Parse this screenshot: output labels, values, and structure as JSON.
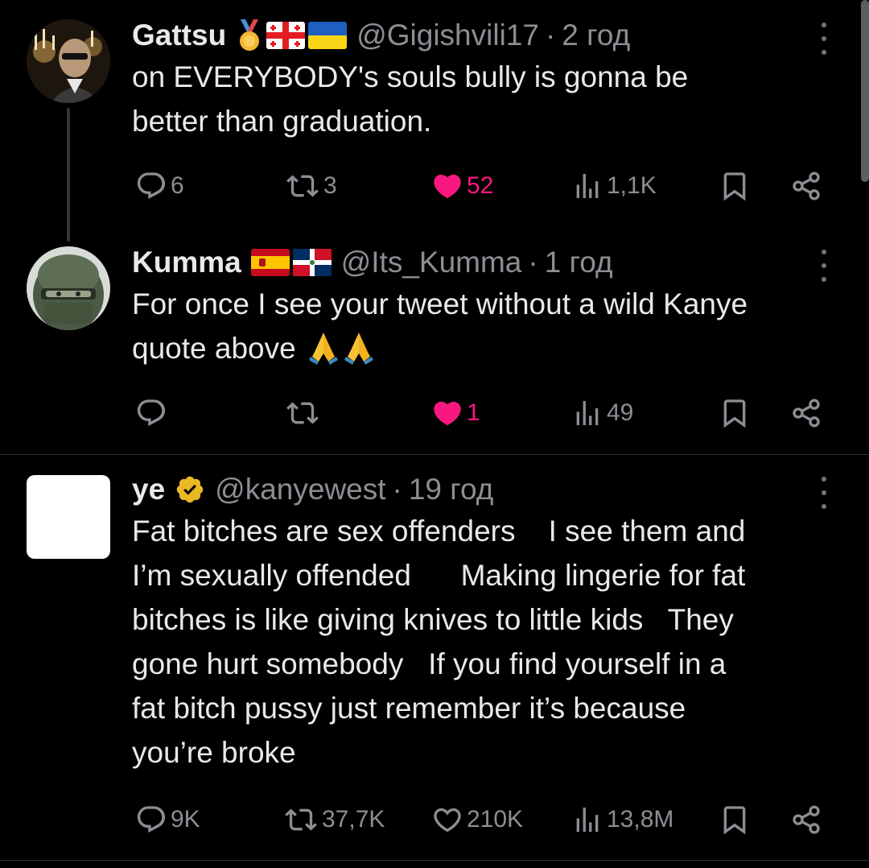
{
  "tweets": [
    {
      "name": "Gattsu",
      "handle": "@Gigishvili17",
      "separator": "·",
      "time": "2 год",
      "text": "on EVERYBODY's souls bully is gonna be\nbetter than graduation.",
      "replies": "6",
      "retweets": "3",
      "likes": "52",
      "views": "1,1K",
      "liked": true
    },
    {
      "name": "Kumma",
      "handle": "@Its_Kumma",
      "separator": "·",
      "time": "1 год",
      "text": "For once I see your tweet without a wild Kanye\nquote above",
      "replies": "",
      "retweets": "",
      "likes": "1",
      "views": "49",
      "liked": true
    },
    {
      "name": "ye",
      "handle": "@kanyewest",
      "separator": "·",
      "time": "19 год",
      "text": "Fat bitches are sex offenders    I see them and\nI’m sexually offended      Making lingerie for fat\nbitches is like giving knives to little kids   They\ngone hurt somebody   If you find yourself in a\nfat bitch pussy just remember it’s because\nyou’re broke",
      "replies": "9K",
      "retweets": "37,7K",
      "likes": "210K",
      "views": "13,8M",
      "liked": false
    }
  ],
  "icons": {
    "reply": "reply-icon",
    "retweet": "retweet-icon",
    "like": "heart-icon",
    "views": "views-icon",
    "bookmark": "bookmark-icon",
    "share": "share-icon",
    "more": "more-icon"
  },
  "colors": {
    "background": "#000000",
    "text": "#e7e9ea",
    "secondary": "#8b8f94",
    "like": "#f91880",
    "verified": "#e8b825"
  }
}
